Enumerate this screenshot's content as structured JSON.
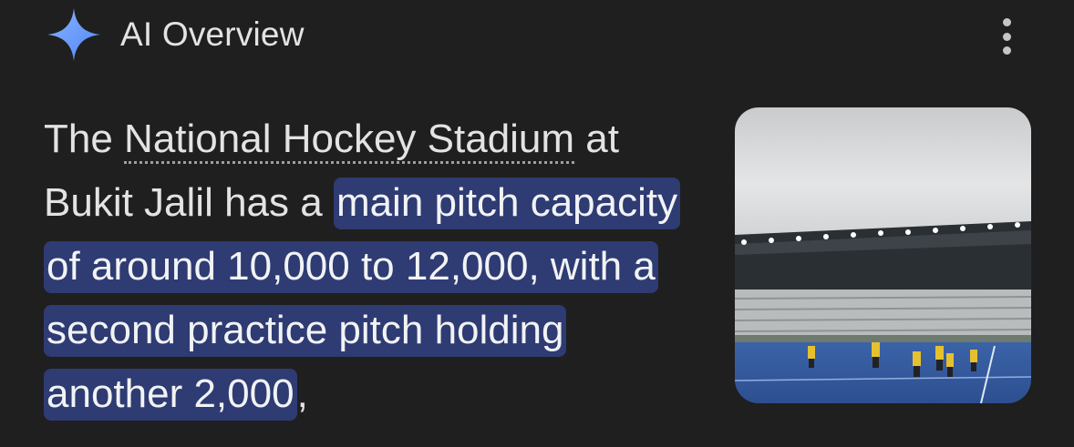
{
  "header": {
    "title": "AI Overview",
    "icon": "sparkle-icon",
    "icon_color": "#6f9bff",
    "more_icon": "more-vert-icon"
  },
  "answer": {
    "text_before": "The ",
    "entity_link": "National Hockey Stadium",
    "text_middle": " at Bukit Jalil has a ",
    "highlighted": "main pitch capacity of around 10,000 to 12,000, with a second practice pitch holding another 2,000",
    "text_after": ",",
    "highlight_color": "#2f3b73"
  },
  "thumbnail": {
    "subject": "hockey-stadium-photo"
  }
}
